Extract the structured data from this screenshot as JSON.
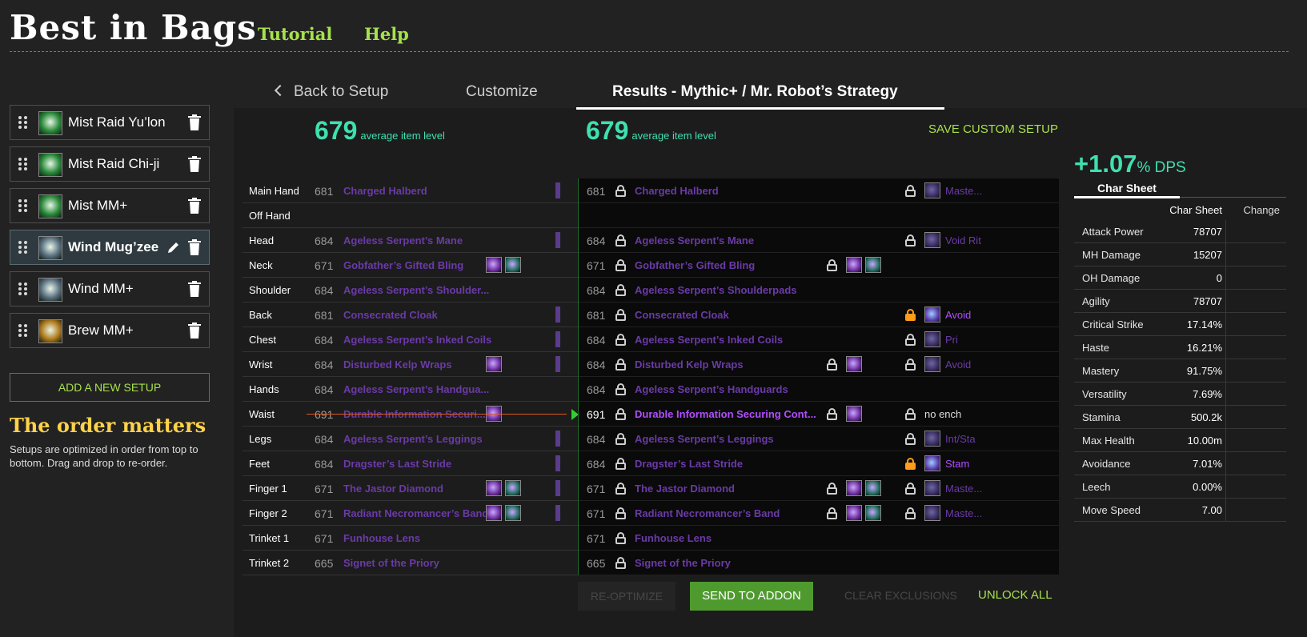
{
  "header": {
    "logo": "Best in Bags",
    "tutorial": "Tutorial",
    "help": "Help"
  },
  "sidebar": {
    "setups": [
      {
        "name": "Mist Raid Yu’lon",
        "icon": "jade-serpent-icon",
        "color": "#2a8a3a",
        "active": false
      },
      {
        "name": "Mist Raid Chi-ji",
        "icon": "jade-serpent-icon",
        "color": "#2a8a3a",
        "active": false
      },
      {
        "name": "Mist MM+",
        "icon": "jade-serpent-icon",
        "color": "#2a8a3a",
        "active": false
      },
      {
        "name": "Wind Mug’zee",
        "icon": "windwalker-icon",
        "color": "#5a7080",
        "active": true
      },
      {
        "name": "Wind MM+",
        "icon": "windwalker-icon",
        "color": "#5a7080",
        "active": false
      },
      {
        "name": "Brew MM+",
        "icon": "brewmaster-icon",
        "color": "#b07a1a",
        "active": false
      }
    ],
    "add_setup": "ADD A NEW SETUP",
    "order_title": "The order matters",
    "order_desc": "Setups are optimized in order from top to bottom. Drag and drop to re-order."
  },
  "tabs": {
    "back": "Back to Setup",
    "customize": "Customize",
    "results": "Results - Mythic+ / Mr. Robot’s Strategy"
  },
  "summary": {
    "left_ilvl": "679",
    "right_ilvl": "679",
    "ilvl_label": "average item level",
    "save_custom": "SAVE CUSTOM SETUP"
  },
  "gear": [
    {
      "slot": "Main Hand",
      "left_ilvl": "681",
      "left_name": "Charged Halberd",
      "right_ilvl": "681",
      "right_name": "Charged Halberd",
      "enchant": "Maste...",
      "enchant_lock": true
    },
    {
      "slot": "Off Hand",
      "left_ilvl": "",
      "left_name": "",
      "right_ilvl": "",
      "right_name": ""
    },
    {
      "slot": "Head",
      "left_ilvl": "684",
      "left_name": "Ageless Serpent’s Mane",
      "right_ilvl": "684",
      "right_name": "Ageless Serpent’s Mane",
      "enchant": "Void Rit",
      "enchant_lock": true
    },
    {
      "slot": "Neck",
      "left_ilvl": "671",
      "left_name": "Gobfather’s Gifted Bling",
      "right_ilvl": "671",
      "right_name": "Gobfather’s Gifted Bling",
      "gems": 2
    },
    {
      "slot": "Shoulder",
      "left_ilvl": "684",
      "left_name": "Ageless Serpent’s Shoulder...",
      "right_ilvl": "684",
      "right_name": "Ageless Serpent’s Shoulderpads"
    },
    {
      "slot": "Back",
      "left_ilvl": "681",
      "left_name": "Consecrated Cloak",
      "right_ilvl": "681",
      "right_name": "Consecrated Cloak",
      "enchant": "Avoid",
      "enchant_lock": true,
      "enchant_locked": true,
      "enchant_bright": true
    },
    {
      "slot": "Chest",
      "left_ilvl": "684",
      "left_name": "Ageless Serpent’s Inked Coils",
      "right_ilvl": "684",
      "right_name": "Ageless Serpent’s Inked Coils",
      "enchant": "Pri",
      "enchant_lock": true
    },
    {
      "slot": "Wrist",
      "left_ilvl": "684",
      "left_name": "Disturbed Kelp Wraps",
      "right_ilvl": "684",
      "right_name": "Disturbed Kelp Wraps",
      "gems": 1,
      "enchant": "Avoid",
      "enchant_lock": true
    },
    {
      "slot": "Hands",
      "left_ilvl": "684",
      "left_name": "Ageless Serpent’s Handgua...",
      "right_ilvl": "684",
      "right_name": "Ageless Serpent’s Handguards"
    },
    {
      "slot": "Waist",
      "left_ilvl": "691",
      "left_name": "Durable Information Securi...",
      "right_ilvl": "691",
      "right_name": "Durable Information Securing Cont...",
      "gems": 1,
      "enchant": "no ench",
      "enchant_lock": true,
      "enchant_plain": true,
      "changed": true
    },
    {
      "slot": "Legs",
      "left_ilvl": "684",
      "left_name": "Ageless Serpent’s Leggings",
      "right_ilvl": "684",
      "right_name": "Ageless Serpent’s Leggings",
      "enchant": "Int/Sta",
      "enchant_lock": true
    },
    {
      "slot": "Feet",
      "left_ilvl": "684",
      "left_name": "Dragster’s Last Stride",
      "right_ilvl": "684",
      "right_name": "Dragster’s Last Stride",
      "enchant": "Stam",
      "enchant_lock": true,
      "enchant_locked": true,
      "enchant_bright": true
    },
    {
      "slot": "Finger 1",
      "left_ilvl": "671",
      "left_name": "The Jastor Diamond",
      "right_ilvl": "671",
      "right_name": "The Jastor Diamond",
      "gems": 2,
      "enchant": "Maste...",
      "enchant_lock": true
    },
    {
      "slot": "Finger 2",
      "left_ilvl": "671",
      "left_name": "Radiant Necromancer’s Band",
      "right_ilvl": "671",
      "right_name": "Radiant Necromancer’s Band",
      "gems": 2,
      "enchant": "Maste...",
      "enchant_lock": true
    },
    {
      "slot": "Trinket 1",
      "left_ilvl": "671",
      "left_name": "Funhouse Lens",
      "right_ilvl": "671",
      "right_name": "Funhouse Lens"
    },
    {
      "slot": "Trinket 2",
      "left_ilvl": "665",
      "left_name": "Signet of the Priory",
      "right_ilvl": "665",
      "right_name": "Signet of the Priory"
    }
  ],
  "buttons": {
    "reoptimize": "RE-OPTIMIZE",
    "send": "SEND TO ADDON",
    "clear": "CLEAR EXCLUSIONS",
    "unlock": "UNLOCK ALL"
  },
  "stats": {
    "dps_value": "+1.07",
    "dps_unit": "% DPS",
    "tab": "Char Sheet",
    "col1": "Char Sheet",
    "col2": "Change",
    "rows": [
      {
        "label": "Attack Power",
        "value": "78707"
      },
      {
        "label": "MH Damage",
        "value": "15207"
      },
      {
        "label": "OH Damage",
        "value": "0"
      },
      {
        "label": "Agility",
        "value": "78707"
      },
      {
        "label": "Critical Strike",
        "value": "17.14%"
      },
      {
        "label": "Haste",
        "value": "16.21%"
      },
      {
        "label": "Mastery",
        "value": "91.75%"
      },
      {
        "label": "Versatility",
        "value": "7.69%"
      },
      {
        "label": "Stamina",
        "value": "500.2k"
      },
      {
        "label": "Max Health",
        "value": "10.00m"
      },
      {
        "label": "Avoidance",
        "value": "7.01%"
      },
      {
        "label": "Leech",
        "value": "0.00%"
      },
      {
        "label": "Move Speed",
        "value": "7.00"
      }
    ]
  }
}
